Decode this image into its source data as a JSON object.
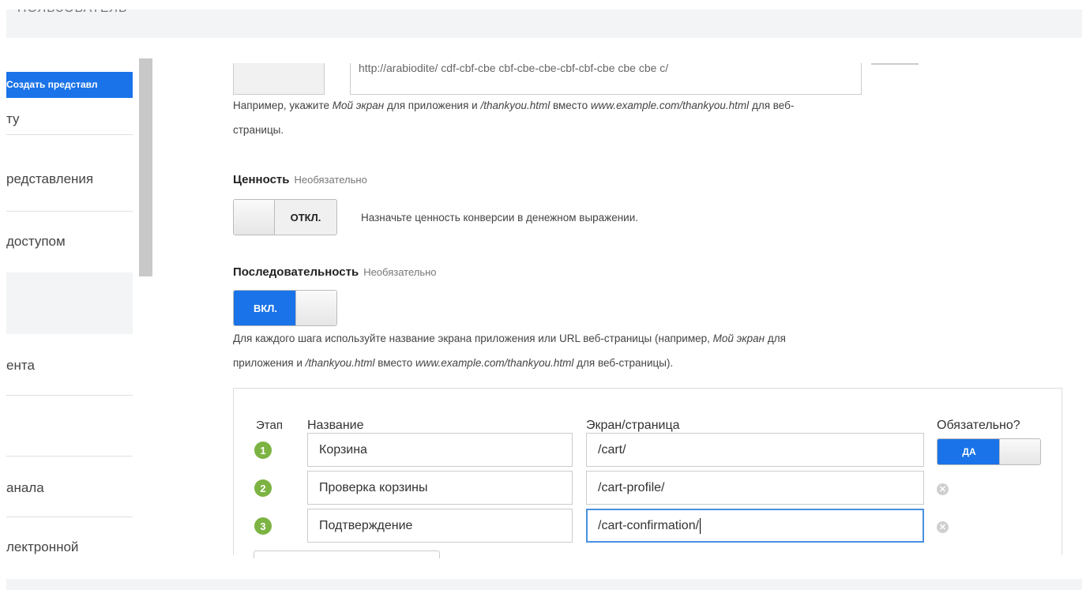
{
  "topbar": {
    "ghost_text": "ПОЛЬЗОВАТЕЛЬ"
  },
  "nav": {
    "create_label": "Создать представл",
    "items": [
      {
        "label": "ту"
      },
      {
        "label": "редставления"
      },
      {
        "label": "доступом"
      },
      {
        "label": "ента"
      },
      {
        "label": "анала"
      },
      {
        "label": "лектронной"
      }
    ]
  },
  "partial_url": "http://arabiodite/ cdf-cbf-cbe cbf-cbe-cbe-cbf-cbf-cbe cbe cbe c/",
  "hint_example": {
    "prefix": "Например, укажите ",
    "italic1": "Мой экран",
    "mid1": " для приложения и ",
    "italic2": "/thankyou.html",
    "mid2": " вместо ",
    "italic3": "www.example.com/thankyou.html",
    "suffix": " для веб-",
    "line2": "страницы."
  },
  "value_section": {
    "title": "Ценность",
    "optional": "Необязательно",
    "toggle_label": "ОТКЛ.",
    "description": "Назначьте ценность конверсии в денежном выражении."
  },
  "sequence_section": {
    "title": "Последовательность",
    "optional": "Необязательно",
    "toggle_label": "ВКЛ.",
    "hint_prefix": "Для каждого шага используйте название экрана приложения или URL веб-страницы (например, ",
    "hint_italic1": "Мой экран",
    "hint_suffix1": " для",
    "hint_line2_prefix": "приложения и ",
    "hint_italic2": "/thankyou.html",
    "hint_mid": " вместо ",
    "hint_italic3": "www.example.com/thankyou.html",
    "hint_line2_suffix": " для веб-страницы)."
  },
  "steps_table": {
    "headers": {
      "step": "Этап",
      "name": "Название",
      "screen": "Экран/страница",
      "required": "Обязательно?"
    },
    "required_toggle_label": "ДА",
    "rows": [
      {
        "num": "1",
        "name": "Корзина",
        "screen": "/cart/"
      },
      {
        "num": "2",
        "name": "Проверка корзины",
        "screen": "/cart-profile/"
      },
      {
        "num": "3",
        "name": "Подтверждение",
        "screen": "/cart-confirmation/"
      }
    ],
    "remove_glyph": "✕"
  }
}
